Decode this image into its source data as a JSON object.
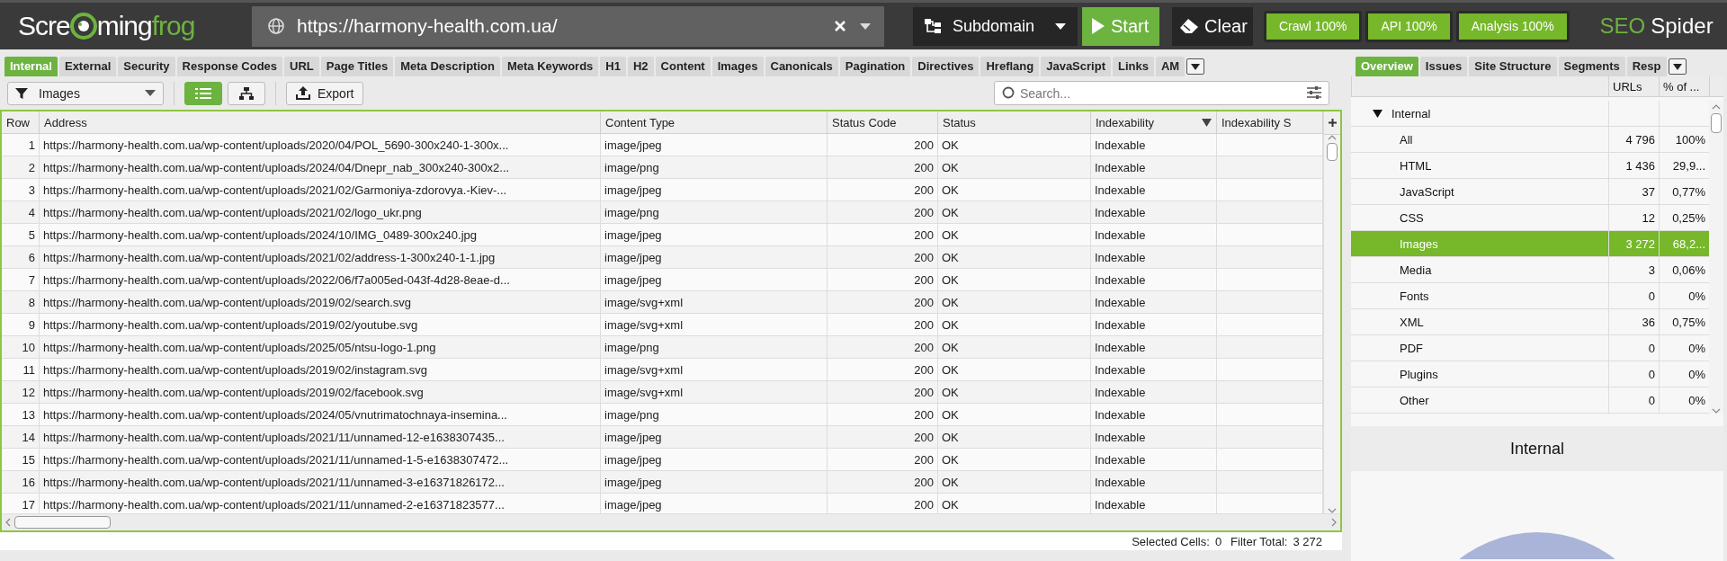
{
  "top_bar": {
    "logo": [
      {
        "text": "Scre",
        "accent": false
      },
      {
        "text": "ming",
        "accent": false
      },
      {
        "text": "frog",
        "accent": true
      }
    ],
    "url": "https://harmony-health.com.ua/",
    "mode": "Subdomain",
    "start": "Start",
    "clear": "Clear",
    "progress": [
      {
        "label": "Crawl 100%"
      },
      {
        "label": "API 100%"
      },
      {
        "label": "Analysis 100%"
      }
    ],
    "product": [
      {
        "text": "SEO",
        "accent": true
      },
      {
        "text": "Spider",
        "accent": false
      }
    ]
  },
  "tabs": [
    {
      "label": "Internal",
      "selected": true
    },
    {
      "label": "External",
      "selected": false
    },
    {
      "label": "Security",
      "selected": false
    },
    {
      "label": "Response Codes",
      "selected": false
    },
    {
      "label": "URL",
      "selected": false
    },
    {
      "label": "Page Titles",
      "selected": false
    },
    {
      "label": "Meta Description",
      "selected": false
    },
    {
      "label": "Meta Keywords",
      "selected": false
    },
    {
      "label": "H1",
      "selected": false
    },
    {
      "label": "H2",
      "selected": false
    },
    {
      "label": "Content",
      "selected": false
    },
    {
      "label": "Images",
      "selected": false
    },
    {
      "label": "Canonicals",
      "selected": false
    },
    {
      "label": "Pagination",
      "selected": false
    },
    {
      "label": "Directives",
      "selected": false
    },
    {
      "label": "Hreflang",
      "selected": false
    },
    {
      "label": "JavaScript",
      "selected": false
    },
    {
      "label": "Links",
      "selected": false
    },
    {
      "label": "AM",
      "selected": false
    }
  ],
  "toolbar": {
    "filter": "Images",
    "views": [
      {
        "kind": "list",
        "selected": true
      },
      {
        "kind": "tree",
        "selected": false
      }
    ],
    "export": "Export",
    "search": {
      "placeholder": "Search..."
    }
  },
  "table": {
    "columns": [
      "Row",
      "Address",
      "Content Type",
      "Status Code",
      "Status",
      "Indexability",
      "Indexability S"
    ],
    "rows": [
      [
        "1",
        "https://harmony-health.com.ua/wp-content/uploads/2020/04/POL_5690-300x240-1-300x...",
        "image/jpeg",
        "200",
        "OK",
        "Indexable"
      ],
      [
        "2",
        "https://harmony-health.com.ua/wp-content/uploads/2024/04/Dnepr_nab_300x240-300x2...",
        "image/png",
        "200",
        "OK",
        "Indexable"
      ],
      [
        "3",
        "https://harmony-health.com.ua/wp-content/uploads/2021/02/Garmoniya-zdorovya.-Kiev-...",
        "image/jpeg",
        "200",
        "OK",
        "Indexable"
      ],
      [
        "4",
        "https://harmony-health.com.ua/wp-content/uploads/2021/02/logo_ukr.png",
        "image/png",
        "200",
        "OK",
        "Indexable"
      ],
      [
        "5",
        "https://harmony-health.com.ua/wp-content/uploads/2024/10/IMG_0489-300x240.jpg",
        "image/jpeg",
        "200",
        "OK",
        "Indexable"
      ],
      [
        "6",
        "https://harmony-health.com.ua/wp-content/uploads/2021/02/address-1-300x240-1-1.jpg",
        "image/jpeg",
        "200",
        "OK",
        "Indexable"
      ],
      [
        "7",
        "https://harmony-health.com.ua/wp-content/uploads/2022/06/f7a005ed-043f-4d28-8eae-d...",
        "image/jpeg",
        "200",
        "OK",
        "Indexable"
      ],
      [
        "8",
        "https://harmony-health.com.ua/wp-content/uploads/2019/02/search.svg",
        "image/svg+xml",
        "200",
        "OK",
        "Indexable"
      ],
      [
        "9",
        "https://harmony-health.com.ua/wp-content/uploads/2019/02/youtube.svg",
        "image/svg+xml",
        "200",
        "OK",
        "Indexable"
      ],
      [
        "10",
        "https://harmony-health.com.ua/wp-content/uploads/2025/05/ntsu-logo-1.png",
        "image/png",
        "200",
        "OK",
        "Indexable"
      ],
      [
        "11",
        "https://harmony-health.com.ua/wp-content/uploads/2019/02/instagram.svg",
        "image/svg+xml",
        "200",
        "OK",
        "Indexable"
      ],
      [
        "12",
        "https://harmony-health.com.ua/wp-content/uploads/2019/02/facebook.svg",
        "image/svg+xml",
        "200",
        "OK",
        "Indexable"
      ],
      [
        "13",
        "https://harmony-health.com.ua/wp-content/uploads/2024/05/vnutrimatochnaya-insemina...",
        "image/png",
        "200",
        "OK",
        "Indexable"
      ],
      [
        "14",
        "https://harmony-health.com.ua/wp-content/uploads/2021/11/unnamed-12-e1638307435...",
        "image/jpeg",
        "200",
        "OK",
        "Indexable"
      ],
      [
        "15",
        "https://harmony-health.com.ua/wp-content/uploads/2021/11/unnamed-1-5-e1638307472...",
        "image/jpeg",
        "200",
        "OK",
        "Indexable"
      ],
      [
        "16",
        "https://harmony-health.com.ua/wp-content/uploads/2021/11/unnamed-3-e16371826172...",
        "image/jpeg",
        "200",
        "OK",
        "Indexable"
      ],
      [
        "17",
        "https://harmony-health.com.ua/wp-content/uploads/2021/11/unnamed-2-e16371823577...",
        "image/jpeg",
        "200",
        "OK",
        "Indexable"
      ]
    ]
  },
  "status_bar": [
    {
      "label": "Selected Cells:",
      "value": "0"
    },
    {
      "label": "Filter Total:",
      "value": "3 272"
    }
  ],
  "right_tabs": [
    {
      "label": "Overview",
      "selected": true
    },
    {
      "label": "Issues",
      "selected": false
    },
    {
      "label": "Site Structure",
      "selected": false
    },
    {
      "label": "Segments",
      "selected": false
    },
    {
      "label": "Resp",
      "selected": false
    }
  ],
  "overview": {
    "columns": [
      "URLs",
      "% of ..."
    ],
    "tree": [
      {
        "label": "Internal",
        "expanded": true,
        "children": [
          {
            "label": "All",
            "urls": "4 796",
            "percent": "100%",
            "selected": false
          },
          {
            "label": "HTML",
            "urls": "1 436",
            "percent": "29,9...",
            "selected": false
          },
          {
            "label": "JavaScript",
            "urls": "37",
            "percent": "0,77%",
            "selected": false
          },
          {
            "label": "CSS",
            "urls": "12",
            "percent": "0,25%",
            "selected": false
          },
          {
            "label": "Images",
            "urls": "3 272",
            "percent": "68,2...",
            "selected": true
          },
          {
            "label": "Media",
            "urls": "3",
            "percent": "0,06%",
            "selected": false
          },
          {
            "label": "Fonts",
            "urls": "0",
            "percent": "0%",
            "selected": false
          },
          {
            "label": "XML",
            "urls": "36",
            "percent": "0,75%",
            "selected": false
          },
          {
            "label": "PDF",
            "urls": "0",
            "percent": "0%",
            "selected": false
          },
          {
            "label": "Plugins",
            "urls": "0",
            "percent": "0%",
            "selected": false
          },
          {
            "label": "Other",
            "urls": "0",
            "percent": "0%",
            "selected": false
          }
        ]
      }
    ],
    "chart_title": "Internal"
  }
}
